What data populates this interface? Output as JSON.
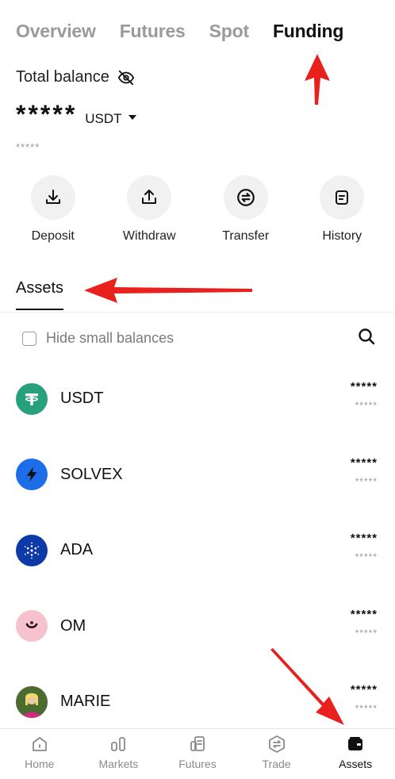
{
  "tabs": [
    "Overview",
    "Futures",
    "Spot",
    "Funding"
  ],
  "active_tab": "Funding",
  "total_balance_label": "Total balance",
  "balance_masked": "*****",
  "currency": "USDT",
  "balance_sub_masked": "*****",
  "actions": [
    {
      "label": "Deposit",
      "icon": "deposit-icon"
    },
    {
      "label": "Withdraw",
      "icon": "withdraw-icon"
    },
    {
      "label": "Transfer",
      "icon": "transfer-icon"
    },
    {
      "label": "History",
      "icon": "history-icon"
    }
  ],
  "assets_heading": "Assets",
  "hide_small_label": "Hide small balances",
  "assets": [
    {
      "name": "USDT",
      "value": "*****",
      "sub": "*****",
      "color": "#26a17b"
    },
    {
      "name": "SOLVEX",
      "value": "*****",
      "sub": "*****",
      "color": "#1e6de8"
    },
    {
      "name": "ADA",
      "value": "*****",
      "sub": "*****",
      "color": "#0d3aa6"
    },
    {
      "name": "OM",
      "value": "*****",
      "sub": "*****",
      "color": "#f7b6c4"
    },
    {
      "name": "MARIE",
      "value": "*****",
      "sub": "*****",
      "color": "#3a5a2a"
    }
  ],
  "nav": [
    {
      "label": "Home",
      "icon": "home-icon"
    },
    {
      "label": "Markets",
      "icon": "markets-icon"
    },
    {
      "label": "Futures",
      "icon": "futures-icon"
    },
    {
      "label": "Trade",
      "icon": "trade-icon"
    },
    {
      "label": "Assets",
      "icon": "wallet-icon"
    }
  ],
  "active_nav": "Assets",
  "annotation_color": "#e8201e"
}
